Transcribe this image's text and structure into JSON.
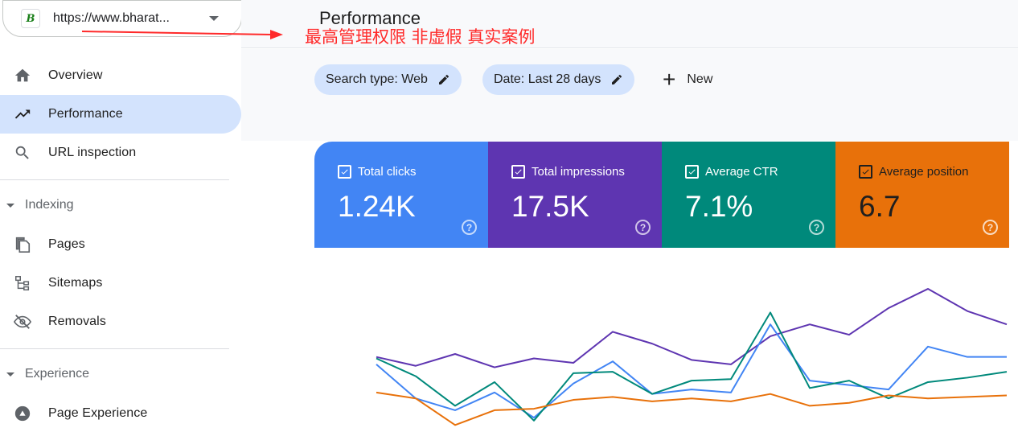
{
  "property": {
    "url": "https://www.bharat...",
    "favicon_letter": "B"
  },
  "sidebar": {
    "items": [
      {
        "label": "Overview",
        "icon": "home-icon"
      },
      {
        "label": "Performance",
        "icon": "trending-up-icon",
        "active": true
      },
      {
        "label": "URL inspection",
        "icon": "search-icon"
      }
    ],
    "indexing": {
      "label": "Indexing",
      "items": [
        {
          "label": "Pages",
          "icon": "pages-icon"
        },
        {
          "label": "Sitemaps",
          "icon": "sitemap-icon"
        },
        {
          "label": "Removals",
          "icon": "eye-off-icon"
        }
      ]
    },
    "experience": {
      "label": "Experience",
      "items": [
        {
          "label": "Page Experience",
          "icon": "page-experience-icon"
        }
      ]
    }
  },
  "header": {
    "title": "Performance"
  },
  "annotation": {
    "text": "最高管理权限   非虚假  真实案例",
    "color": "#ff2a2a"
  },
  "filters": {
    "search_type": "Search type: Web",
    "date": "Date: Last 28 days",
    "new_label": "New"
  },
  "metrics": [
    {
      "label": "Total clicks",
      "value": "1.24K",
      "color": "#4285f4"
    },
    {
      "label": "Total impressions",
      "value": "17.5K",
      "color": "#5e35b1"
    },
    {
      "label": "Average CTR",
      "value": "7.1%",
      "color": "#00897b"
    },
    {
      "label": "Average position",
      "value": "6.7",
      "color": "#e8710a"
    }
  ],
  "chart_data": {
    "type": "line",
    "series": [
      {
        "metric": "impressions",
        "color": "#5e35b1",
        "values": [
          0.48,
          0.42,
          0.5,
          0.41,
          0.47,
          0.44,
          0.65,
          0.57,
          0.46,
          0.43,
          0.62,
          0.7,
          0.63,
          0.81,
          0.94,
          0.79,
          0.7
        ]
      },
      {
        "metric": "clicks",
        "color": "#4285f4",
        "values": [
          0.43,
          0.2,
          0.12,
          0.24,
          0.07,
          0.3,
          0.45,
          0.23,
          0.26,
          0.24,
          0.7,
          0.32,
          0.29,
          0.26,
          0.55,
          0.48,
          0.48
        ]
      },
      {
        "metric": "ctr",
        "color": "#00897b",
        "values": [
          0.47,
          0.35,
          0.15,
          0.31,
          0.05,
          0.37,
          0.38,
          0.23,
          0.32,
          0.33,
          0.78,
          0.27,
          0.32,
          0.2,
          0.31,
          0.34,
          0.38
        ]
      },
      {
        "metric": "position",
        "color": "#e8710a",
        "values": [
          0.24,
          0.2,
          0.02,
          0.12,
          0.13,
          0.19,
          0.21,
          0.18,
          0.2,
          0.18,
          0.23,
          0.15,
          0.17,
          0.22,
          0.2,
          0.21,
          0.22
        ]
      }
    ]
  }
}
